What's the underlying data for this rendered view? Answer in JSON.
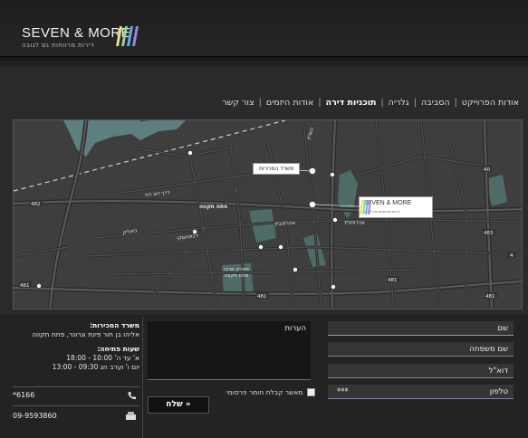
{
  "header": {
    "logo_text": "SEVEN & MORE",
    "logo_sub": "דירות מרווחות גם לגובה"
  },
  "nav": [
    {
      "label": "אודות הפרוייקט",
      "active": false
    },
    {
      "label": "הסביבה",
      "active": false
    },
    {
      "label": "גלריה",
      "active": false
    },
    {
      "label": "תוכניות דירה",
      "active": true
    },
    {
      "label": "אודות היזמים",
      "active": false
    },
    {
      "label": "צור קשר",
      "active": false
    }
  ],
  "map": {
    "labels": {
      "petah_tikva": "פתח תקווה",
      "dov_hoz": "דרך דוב הוז",
      "zabotinsky": "ז'בוטינסקי",
      "aharonovitz": "אהרונוביץ",
      "hsharon": "השרון",
      "bialik": "ביאליק",
      "central_park": "פארק מרכז פתח תקווה",
      "road_481": "481",
      "road_482": "482",
      "road_40": "40",
      "road_483": "483",
      "road_4": "4"
    },
    "callout": "משרד המכירות",
    "map_logo": "SEVEN & MORE",
    "map_logo_sub": "דירות מרווחות גם לגובה"
  },
  "info": {
    "office_title": "משרד המכירות:",
    "office_address": "אליהו בן חור פינת וגרונר, פתח תקווה",
    "hours_title": "שעות פתיחה:",
    "hours_1": "א' עד ה' 10:00 - 18:00",
    "hours_2": "יום ו' וערב חג 09:30 - 13:00",
    "phone": "*6166",
    "fax": "09-9593860"
  },
  "form": {
    "first_name": "שם",
    "last_name": "שם משפחה",
    "email": "דוא\"ל",
    "phone": "טלפון",
    "phone_prefix": "***",
    "notes": "הערות",
    "consent": "מאשר קבלת חומר פרסומי",
    "send": "שלח »"
  },
  "colors": {
    "header_bg": "#1e1e1e",
    "map_bg": "#3e3e3e",
    "road": "#5a5a5a",
    "water": "#5e7f80",
    "park": "#4e6b68",
    "stripe_yellow": "#e8e07a",
    "stripe_green": "#8fd3a0",
    "stripe_blue": "#6fa8e0",
    "stripe_purple": "#9a88d8"
  }
}
